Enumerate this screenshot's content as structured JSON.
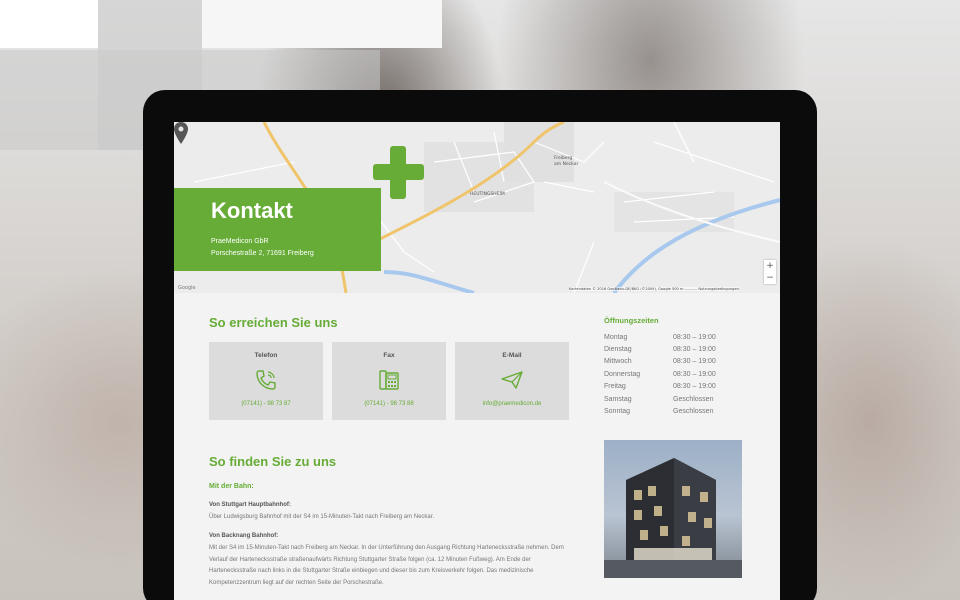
{
  "map": {
    "attribution": "Kartendaten © 2016 GeoBasis-DE/BKG (©2009), Google    500 m ⎯⎯⎯⎯⎯⎯⎯    Nutzungsbedingungen",
    "google_label": "Google",
    "zoom_in": "+",
    "zoom_out": "−"
  },
  "kontakt": {
    "title": "Kontakt",
    "company": "PraeMedicon GbR",
    "address": "Porschestraße 2, 71691 Freiberg"
  },
  "reach": {
    "heading": "So erreichen Sie uns",
    "cards": [
      {
        "title": "Telefon",
        "value": "(07141) - 98 73 87",
        "icon": "phone-icon"
      },
      {
        "title": "Fax",
        "value": "(07141) - 98 73 88",
        "icon": "fax-icon"
      },
      {
        "title": "E-Mail",
        "value": "info@praemedicon.de",
        "icon": "paper-plane-icon"
      }
    ]
  },
  "hours": {
    "title": "Öffnungszeiten",
    "rows": [
      {
        "day": "Montag",
        "time": "08:30 – 19:00"
      },
      {
        "day": "Dienstag",
        "time": "08:30 – 19:00"
      },
      {
        "day": "Mittwoch",
        "time": "08:30 – 19:00"
      },
      {
        "day": "Donnerstag",
        "time": "08:30 – 19:00"
      },
      {
        "day": "Freitag",
        "time": "08:30 – 19:00"
      },
      {
        "day": "Samstag",
        "time": "Geschlossen"
      },
      {
        "day": "Sonntag",
        "time": "Geschlossen"
      }
    ]
  },
  "find": {
    "heading": "So finden Sie zu uns",
    "by_train": "Mit der Bahn:",
    "from_stuttgart_head": "Von Stuttgart Hauptbahnhof:",
    "from_stuttgart_text": "Über Ludwigsburg Bahnhof mit der S4 im 15-Minuten-Takt nach Freiberg am Neckar.",
    "from_backnang_head": "Von Backnang Bahnhof:",
    "from_backnang_text": "Mit der S4 im 15-Minuten-Takt nach Freiberg am Neckar. In der Unterführung den Ausgang Richtung Hartenecksstraße nehmen. Dem Verlauf der Hartenecksstraße straßenaufwärts Richtung Stuttgarter Straße folgen (ca. 12 Minuten Fußweg). Am Ende der Hartenecksstraße nach links in die Stuttgarter Straße einbiegen und dieser bis zum Kreisverkehr folgen. Das medizinische Kompetenzzentrum liegt auf der rechten Seite der Porschestraße."
  },
  "colors": {
    "brand_green": "#66ac36",
    "card_bg": "#dcdcdc",
    "page_bg": "#f3f3f3"
  }
}
